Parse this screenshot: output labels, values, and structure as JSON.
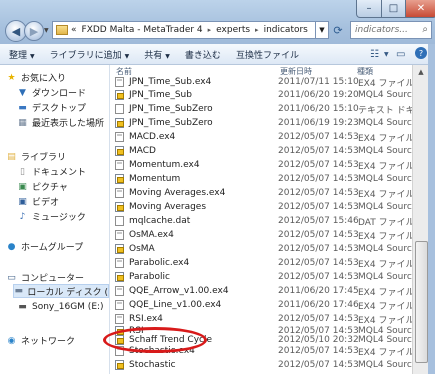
{
  "window": {
    "minimize_glyph": "–",
    "maximize_glyph": "□",
    "close_glyph": "✕"
  },
  "nav": {
    "back_glyph": "◀",
    "forward_glyph": "▶"
  },
  "address": {
    "prefix": "«",
    "crumbs": [
      "FXDD Malta - MetaTrader 4",
      "experts",
      "indicators"
    ],
    "separator": "▸"
  },
  "search": {
    "placeholder": "indicators..."
  },
  "toolbar": {
    "organize": "整理",
    "add_to_library": "ライブラリに追加",
    "share": "共有",
    "burn": "書き込む",
    "compatibility": "互換性ファイル"
  },
  "sidebar": {
    "favorites": "お気に入り",
    "downloads": "ダウンロード",
    "desktop": "デスクトップ",
    "recent": "最近表示した場所",
    "libraries": "ライブラリ",
    "documents": "ドキュメント",
    "pictures": "ピクチャ",
    "videos": "ビデオ",
    "music": "ミュージック",
    "homegroup": "ホームグループ",
    "computer": "コンピューター",
    "local_disk": "ローカル ディスク (",
    "usb": "Sony_16GM (E:)",
    "network": "ネットワーク"
  },
  "columns": {
    "name": "名前",
    "date": "更新日時",
    "type": "種類"
  },
  "files": [
    {
      "name": "JPN_Time_Sub.ex4",
      "date": "2011/07/11 15:10",
      "type": "EX4 ファイル",
      "icon": "ex4-file"
    },
    {
      "name": "JPN_Time_Sub",
      "date": "2011/06/20 19:20",
      "type": "MQL4 Source F",
      "icon": "mql4-source-file"
    },
    {
      "name": "JPN_Time_SubZero",
      "date": "2011/06/20 15:10",
      "type": "テキスト ドキュ",
      "icon": "text-file"
    },
    {
      "name": "JPN_Time_SubZero",
      "date": "2011/06/19 19:23",
      "type": "MQL4 Source F",
      "icon": "mql4-source-file"
    },
    {
      "name": "MACD.ex4",
      "date": "2012/05/07 14:53",
      "type": "EX4 ファイル",
      "icon": "ex4-file"
    },
    {
      "name": "MACD",
      "date": "2012/05/07 14:53",
      "type": "MQL4 Source F",
      "icon": "mql4-source-file"
    },
    {
      "name": "Momentum.ex4",
      "date": "2012/05/07 14:53",
      "type": "EX4 ファイル",
      "icon": "ex4-file"
    },
    {
      "name": "Momentum",
      "date": "2012/05/07 14:53",
      "type": "MQL4 Source F",
      "icon": "mql4-source-file"
    },
    {
      "name": "Moving Averages.ex4",
      "date": "2012/05/07 14:53",
      "type": "EX4 ファイル",
      "icon": "ex4-file"
    },
    {
      "name": "Moving Averages",
      "date": "2012/05/07 14:53",
      "type": "MQL4 Source F",
      "icon": "mql4-source-file"
    },
    {
      "name": "mqlcache.dat",
      "date": "2012/05/07 15:46",
      "type": "DAT ファイル",
      "icon": "dat-file"
    },
    {
      "name": "OsMA.ex4",
      "date": "2012/05/07 14:53",
      "type": "EX4 ファイル",
      "icon": "ex4-file"
    },
    {
      "name": "OsMA",
      "date": "2012/05/07 14:53",
      "type": "MQL4 Source F",
      "icon": "mql4-source-file"
    },
    {
      "name": "Parabolic.ex4",
      "date": "2012/05/07 14:53",
      "type": "EX4 ファイル",
      "icon": "ex4-file"
    },
    {
      "name": "Parabolic",
      "date": "2012/05/07 14:53",
      "type": "MQL4 Source F",
      "icon": "mql4-source-file"
    },
    {
      "name": "QQE_Arrow_v1.00.ex4",
      "date": "2011/06/20 17:45",
      "type": "EX4 ファイル",
      "icon": "ex4-file"
    },
    {
      "name": "QQE_Line_v1.00.ex4",
      "date": "2011/06/20 17:46",
      "type": "EX4 ファイル",
      "icon": "ex4-file"
    },
    {
      "name": "RSI.ex4",
      "date": "2012/05/07 14:53",
      "type": "EX4 ファイル",
      "icon": "ex4-file"
    },
    {
      "name": "RSI",
      "date": "2012/05/07 14:53",
      "type": "MQL4 Source F",
      "icon": "mql4-source-file"
    },
    {
      "name": "Schaff Trend Cycle",
      "date": "2012/05/10 20:32",
      "type": "MQL4 Source F",
      "icon": "mql4-source-file"
    },
    {
      "name": "Stochastic.ex4",
      "date": "2012/05/07 14:53",
      "type": "EX4 ファイル",
      "icon": "ex4-file"
    },
    {
      "name": "Stochastic",
      "date": "2012/05/07 14:53",
      "type": "MQL4 Source F",
      "icon": "mql4-source-file"
    }
  ],
  "colors": {
    "highlight_circle": "#d81a1a",
    "selected_nav": "#d9e8f8"
  }
}
